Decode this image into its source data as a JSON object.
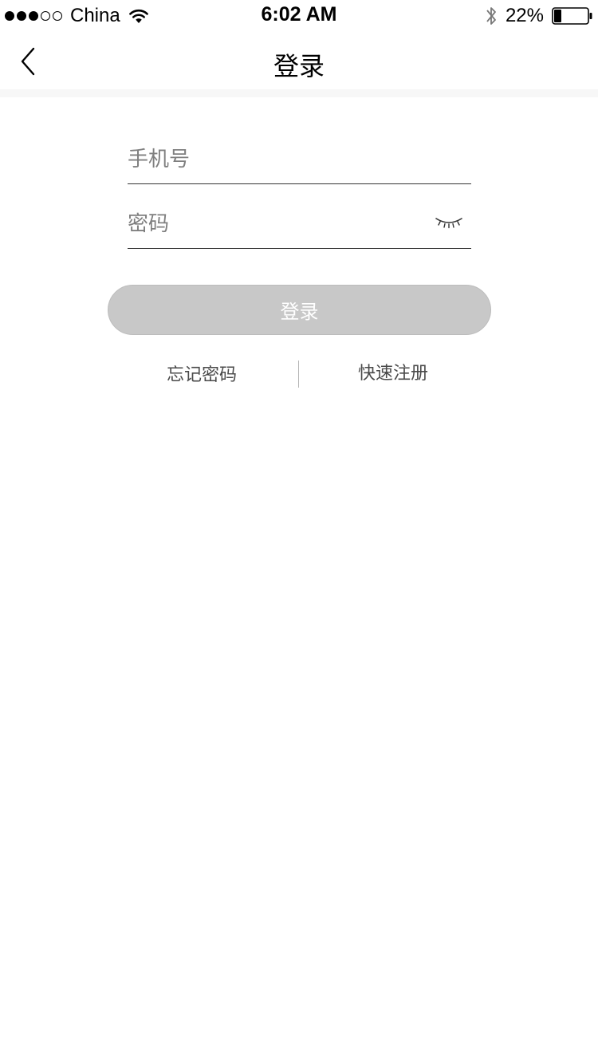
{
  "status_bar": {
    "carrier": "China",
    "time": "6:02 AM",
    "battery_percent": "22%",
    "battery_level": 0.22,
    "signal_strength": 3,
    "signal_max": 5,
    "icons": [
      "wifi-icon",
      "bluetooth-icon",
      "battery-icon"
    ]
  },
  "nav": {
    "title": "登录",
    "back_icon": "chevron-left-icon"
  },
  "form": {
    "phone": {
      "placeholder": "手机号",
      "value": ""
    },
    "password": {
      "placeholder": "密码",
      "value": "",
      "toggle_icon": "eye-closed-icon"
    },
    "login_label": "登录",
    "login_button_color": "#c8c8c8"
  },
  "links": {
    "forgot_password": "忘记密码",
    "quick_register": "快速注册"
  }
}
